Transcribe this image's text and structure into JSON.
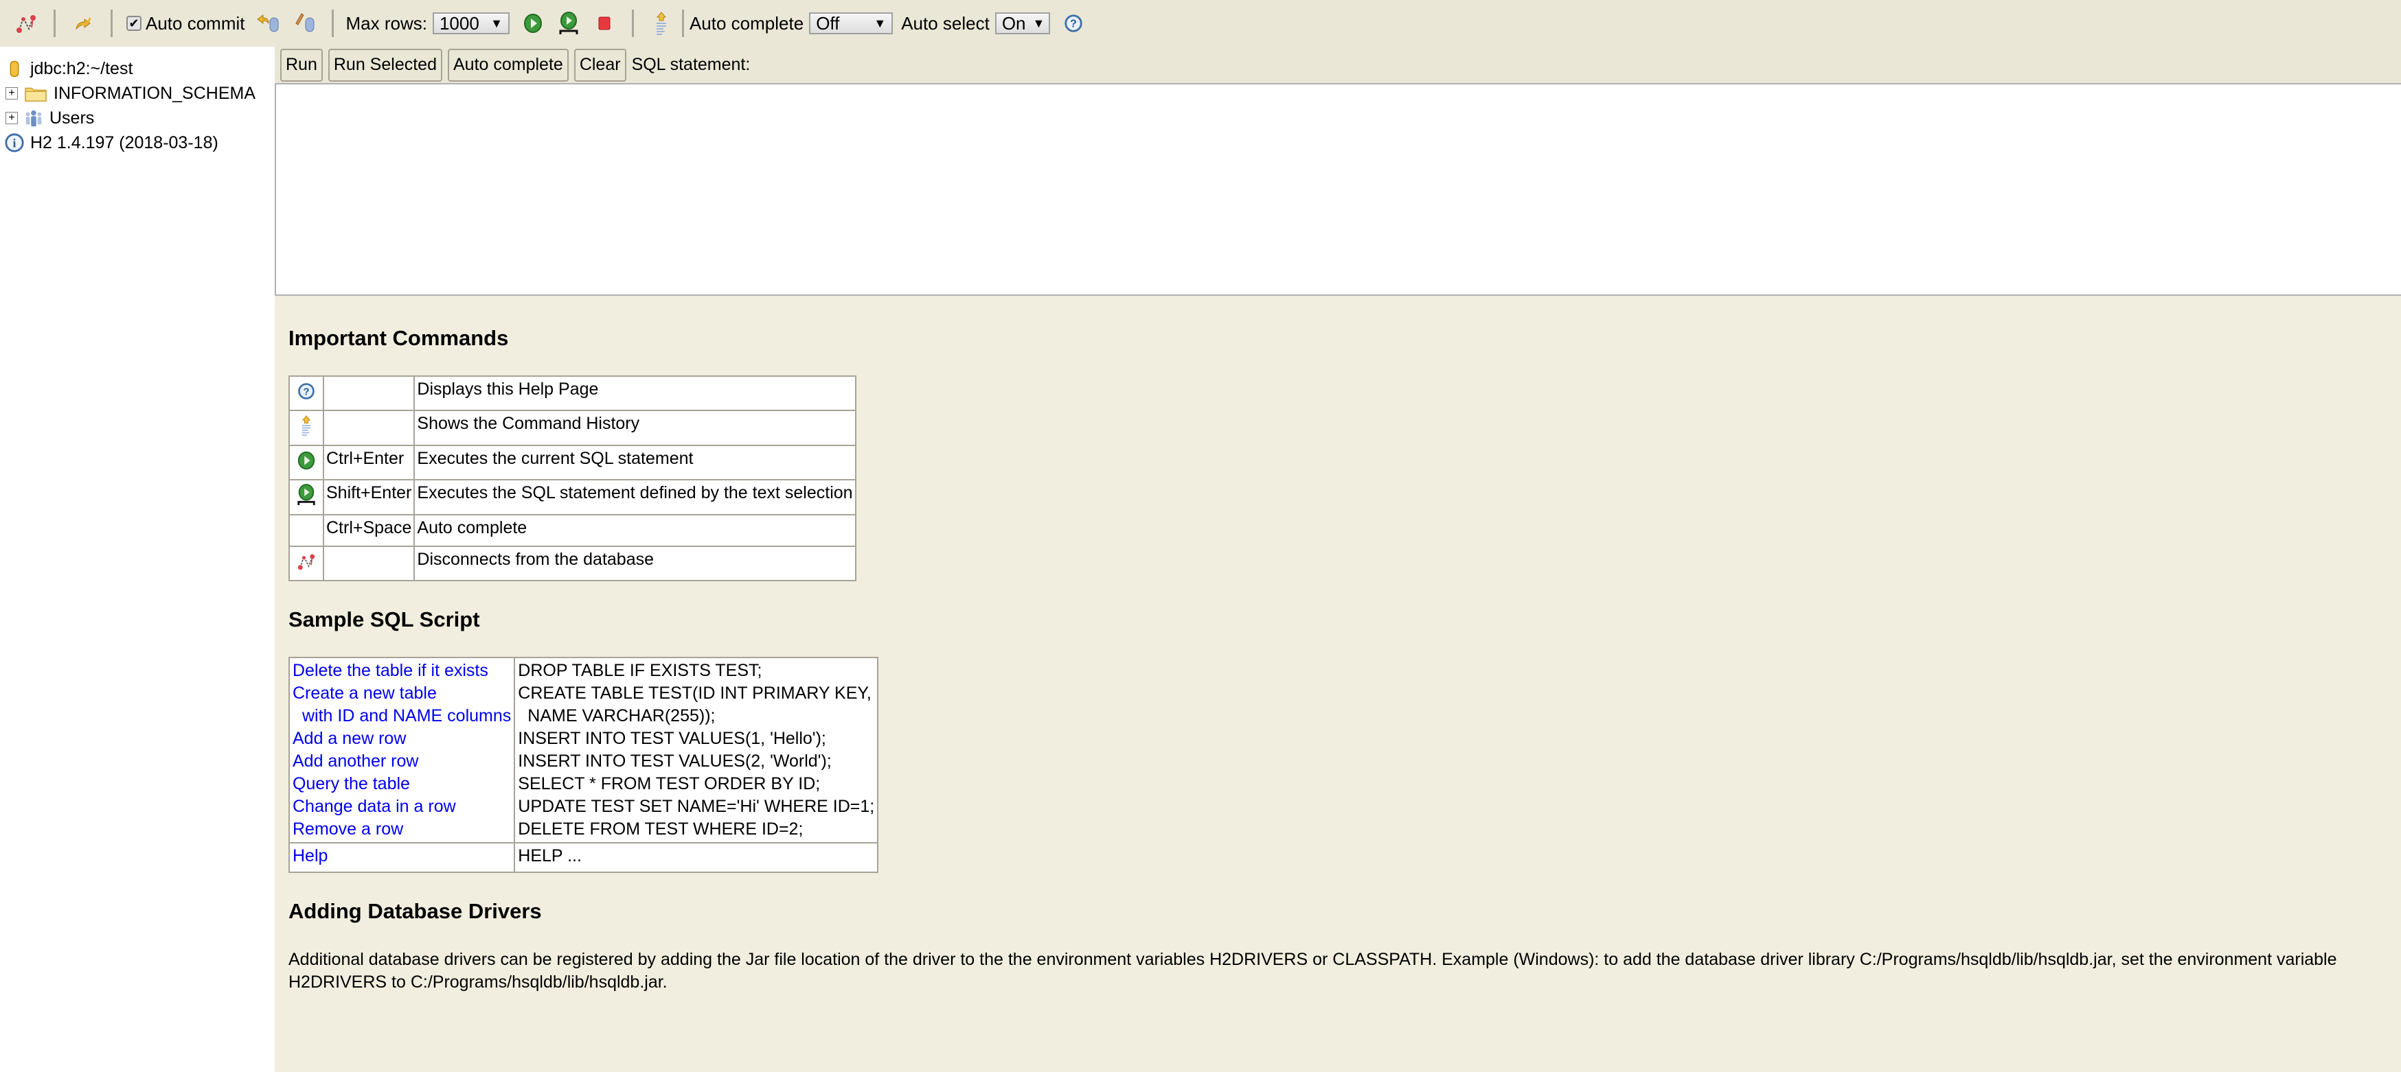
{
  "toolbar": {
    "disconnect_icon": "disconnect-icon",
    "refresh_icon": "refresh-icon",
    "auto_commit_label": "Auto commit",
    "auto_commit_checked": true,
    "rollback_icon": "rollback-icon",
    "commit_icon": "commit-icon",
    "max_rows_label": "Max rows:",
    "max_rows_value": "1000",
    "run_icon": "run-icon",
    "run_selected_icon": "run-selected-icon",
    "stop_icon": "stop-icon",
    "history_icon": "history-icon",
    "auto_complete_label": "Auto complete",
    "auto_complete_value": "Off",
    "auto_select_label": "Auto select",
    "auto_select_value": "On",
    "help_icon": "help-icon"
  },
  "sidebar": {
    "connection": "jdbc:h2:~/test",
    "items": [
      {
        "label": "INFORMATION_SCHEMA",
        "icon": "folder-icon",
        "expander": "+"
      },
      {
        "label": "Users",
        "icon": "users-icon",
        "expander": "+"
      }
    ],
    "version": "H2 1.4.197 (2018-03-18)"
  },
  "sqlbar": {
    "run": "Run",
    "run_selected": "Run Selected",
    "auto_complete": "Auto complete",
    "clear": "Clear",
    "label": "SQL statement:",
    "editor_value": ""
  },
  "help": {
    "important_title": "Important Commands",
    "commands": [
      {
        "icon": "help-icon",
        "key": "",
        "desc": "Displays this Help Page"
      },
      {
        "icon": "history-icon",
        "key": "",
        "desc": "Shows the Command History"
      },
      {
        "icon": "run-icon",
        "key": "Ctrl+Enter",
        "desc": "Executes the current SQL statement"
      },
      {
        "icon": "run-selected-icon",
        "key": "Shift+Enter",
        "desc": "Executes the SQL statement defined by the text selection"
      },
      {
        "icon": "",
        "key": "Ctrl+Space",
        "desc": "Auto complete"
      },
      {
        "icon": "disconnect-icon",
        "key": "",
        "desc": "Disconnects from the database"
      }
    ],
    "sample_title": "Sample SQL Script",
    "sample": [
      {
        "label": "Delete the table if it exists",
        "sql": "DROP TABLE IF EXISTS TEST;"
      },
      {
        "label": "Create a new table",
        "sql": "CREATE TABLE TEST(ID INT PRIMARY KEY,"
      },
      {
        "label": "with ID and NAME columns",
        "sql": "NAME VARCHAR(255));"
      },
      {
        "label": "Add a new row",
        "sql": "INSERT INTO TEST VALUES(1, 'Hello');"
      },
      {
        "label": "Add another row",
        "sql": "INSERT INTO TEST VALUES(2, 'World');"
      },
      {
        "label": "Query the table",
        "sql": "SELECT * FROM TEST ORDER BY ID;"
      },
      {
        "label": "Change data in a row",
        "sql": "UPDATE TEST SET NAME='Hi' WHERE ID=1;"
      },
      {
        "label": "Remove a row",
        "sql": "DELETE FROM TEST WHERE ID=2;"
      }
    ],
    "help_row": {
      "label": "Help",
      "sql": "HELP ..."
    },
    "drivers_title": "Adding Database Drivers",
    "drivers_text": "Additional database drivers can be registered by adding the Jar file location of the driver to the the environment variables H2DRIVERS or CLASSPATH. Example (Windows): to add the database driver library C:/Programs/hsqldb/lib/hsqldb.jar, set the environment variable H2DRIVERS to C:/Programs/hsqldb/lib/hsqldb.jar."
  },
  "colors": {
    "toolbar_bg": "#ebe7d7",
    "help_bg": "#f2eedf",
    "link": "#0000ee",
    "table_border": "#a8a398"
  }
}
